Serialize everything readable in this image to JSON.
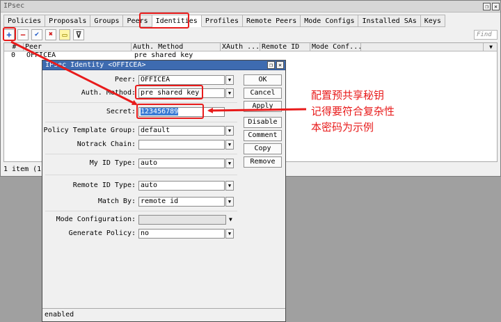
{
  "window": {
    "title": "IPsec"
  },
  "tabs": [
    "Policies",
    "Proposals",
    "Groups",
    "Peers",
    "Identities",
    "Profiles",
    "Remote Peers",
    "Mode Configs",
    "Installed SAs",
    "Keys"
  ],
  "active_tab": "Identities",
  "toolbar": {
    "add": "+",
    "remove": "−",
    "enable": "✔",
    "disable": "✖",
    "comment": "▭",
    "filter": "⊽",
    "find_placeholder": "Find"
  },
  "table": {
    "headers": [
      "#",
      "Peer",
      "Auth. Method",
      "XAuth ...",
      "Remote ID",
      "Mode Conf...",
      ""
    ],
    "rows": [
      {
        "num": "0",
        "peer": "OFFICEA",
        "auth": "pre shared key"
      }
    ],
    "status": "1 item (1"
  },
  "dialog": {
    "title": "IPsec Identity <OFFICEA>",
    "fields": {
      "peer_label": "Peer:",
      "peer_value": "OFFICEA",
      "auth_label": "Auth. Method:",
      "auth_value": "pre shared key",
      "secret_label": "Secret:",
      "secret_value": "123456789",
      "ptg_label": "Policy Template Group:",
      "ptg_value": "default",
      "notrack_label": "Notrack Chain:",
      "notrack_value": "",
      "myid_label": "My ID Type:",
      "myid_value": "auto",
      "remoteid_label": "Remote ID Type:",
      "remoteid_value": "auto",
      "matchby_label": "Match By:",
      "matchby_value": "remote id",
      "modeconf_label": "Mode Configuration:",
      "modeconf_value": "",
      "genpol_label": "Generate Policy:",
      "genpol_value": "no"
    },
    "buttons": [
      "OK",
      "Cancel",
      "Apply",
      "Disable",
      "Comment",
      "Copy",
      "Remove"
    ],
    "status": "enabled"
  },
  "annotation": {
    "lines": [
      "配置预共享秘钥",
      "记得要符合复杂性",
      "本密码为示例"
    ],
    "color": "#e81b1b"
  }
}
